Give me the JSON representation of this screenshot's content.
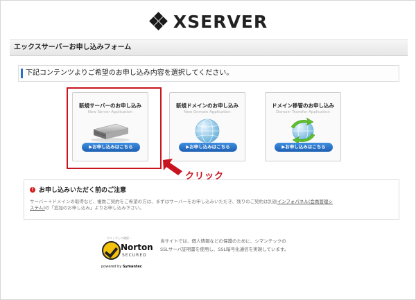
{
  "header": {
    "logo_text": "XSERVER",
    "form_title": "エックスサーバーお申し込みフォーム"
  },
  "instruction": "下記コンテンツよりご希望のお申し込み内容を選択してください。",
  "cards": [
    {
      "title": "新規サーバーのお申し込み",
      "subtitle": "New Server Application",
      "icon": "server-icon",
      "button": "▶お申し込みはこちら"
    },
    {
      "title": "新規ドメインのお申し込み",
      "subtitle": "New Domain Application",
      "icon": "globe-icon",
      "button": "▶お申し込みはこちら"
    },
    {
      "title": "ドメイン移管のお申し込み",
      "subtitle": "Domain Transfer Application",
      "icon": "globe-transfer-icon",
      "button": "▶お申し込みはこちら"
    }
  ],
  "annotation": {
    "click_label": "クリック"
  },
  "notice": {
    "title": "お申し込みいただく前のご注意",
    "body_1": "サーバー＋ドメインの取得など、複数ご契約をご希望の方は、まずはサーバーをお申し込みいただき、残りのご契約は別途",
    "link_1": "インフォパネル(会員管理シ",
    "link_2": "ステム)",
    "body_2": "の「追加のお申し込み」よりお申し込み下さい。"
  },
  "norton": {
    "top_text": "クリックして確認 ›",
    "name": "Norton",
    "secured": "SECURED",
    "powered_by": "powered by",
    "vendor": "Symantec"
  },
  "ssl_text": {
    "line_1": "当サイトでは、個人情報などの保護のために、シマンテックの",
    "line_2": "SSLサーバ証明書を使用し、SSL暗号化通信を実現しています。"
  },
  "colors": {
    "accent_blue": "#1d5fb3",
    "highlight_red": "#c8141e"
  }
}
